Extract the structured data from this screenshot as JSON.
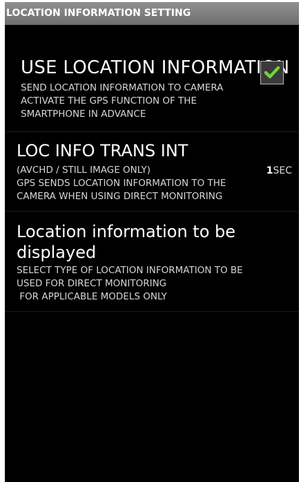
{
  "title_bar": {
    "text": "LOCATION INFORMATION SETTING"
  },
  "settings": [
    {
      "title": "USE LOCATION INFORMATION",
      "description_lines": [
        "SEND LOCATION INFORMATION TO CAMERA",
        "ACTIVATE THE GPS FUNCTION OF THE",
        "SMARTPHONE IN ADVANCE"
      ],
      "checked": true,
      "check_color": "#6fd43a"
    },
    {
      "title": "LOC INFO TRANS INT",
      "description_lines": [
        "(AVCHD / STILL IMAGE ONLY)",
        "GPS SENDS LOCATION INFORMATION TO THE",
        "CAMERA WHEN USING DIRECT MONITORING"
      ],
      "value_number": "1",
      "value_unit": "SEC"
    },
    {
      "title": "Location information to be displayed",
      "description_lines": [
        "SELECT TYPE OF LOCATION INFORMATION TO BE",
        "USED FOR DIRECT MONITORING",
        " FOR APPLICABLE MODELS ONLY"
      ]
    }
  ]
}
